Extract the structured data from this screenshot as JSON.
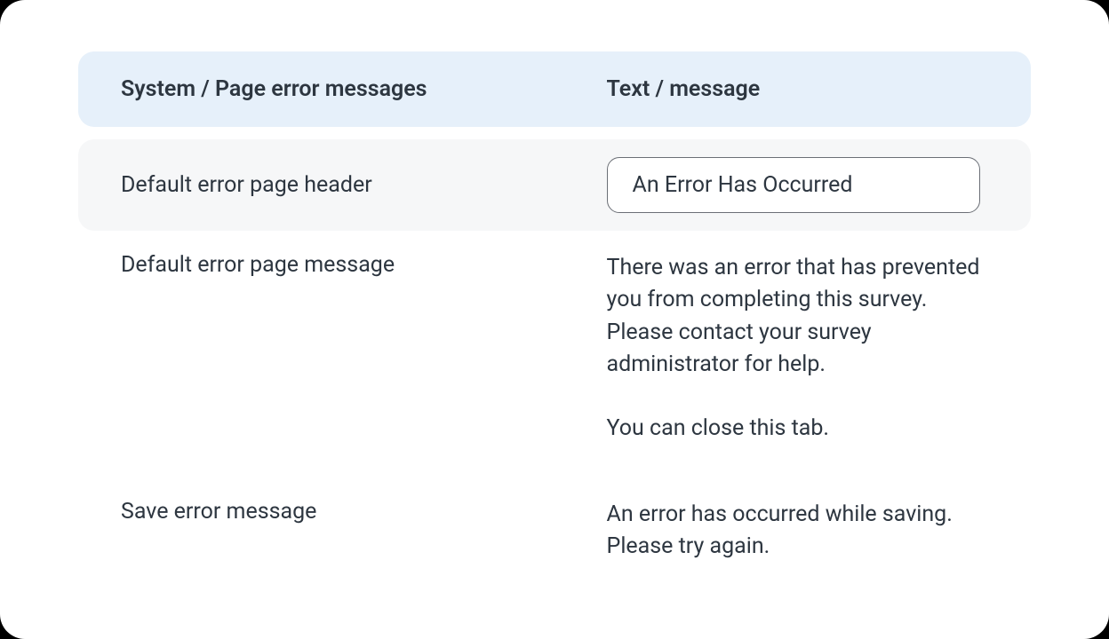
{
  "header": {
    "col1": "System / Page error messages",
    "col2": "Text / message"
  },
  "rows": [
    {
      "label": "Default error page header",
      "value": "An Error Has Occurred",
      "input": true
    },
    {
      "label": "Default error page message",
      "value": "There was an error that has prevented you from completing this survey. Please contact your survey administrator for help.\n\nYou can close this tab."
    },
    {
      "label": "Save error message",
      "value": "An error has occurred while saving. Please try again."
    }
  ]
}
